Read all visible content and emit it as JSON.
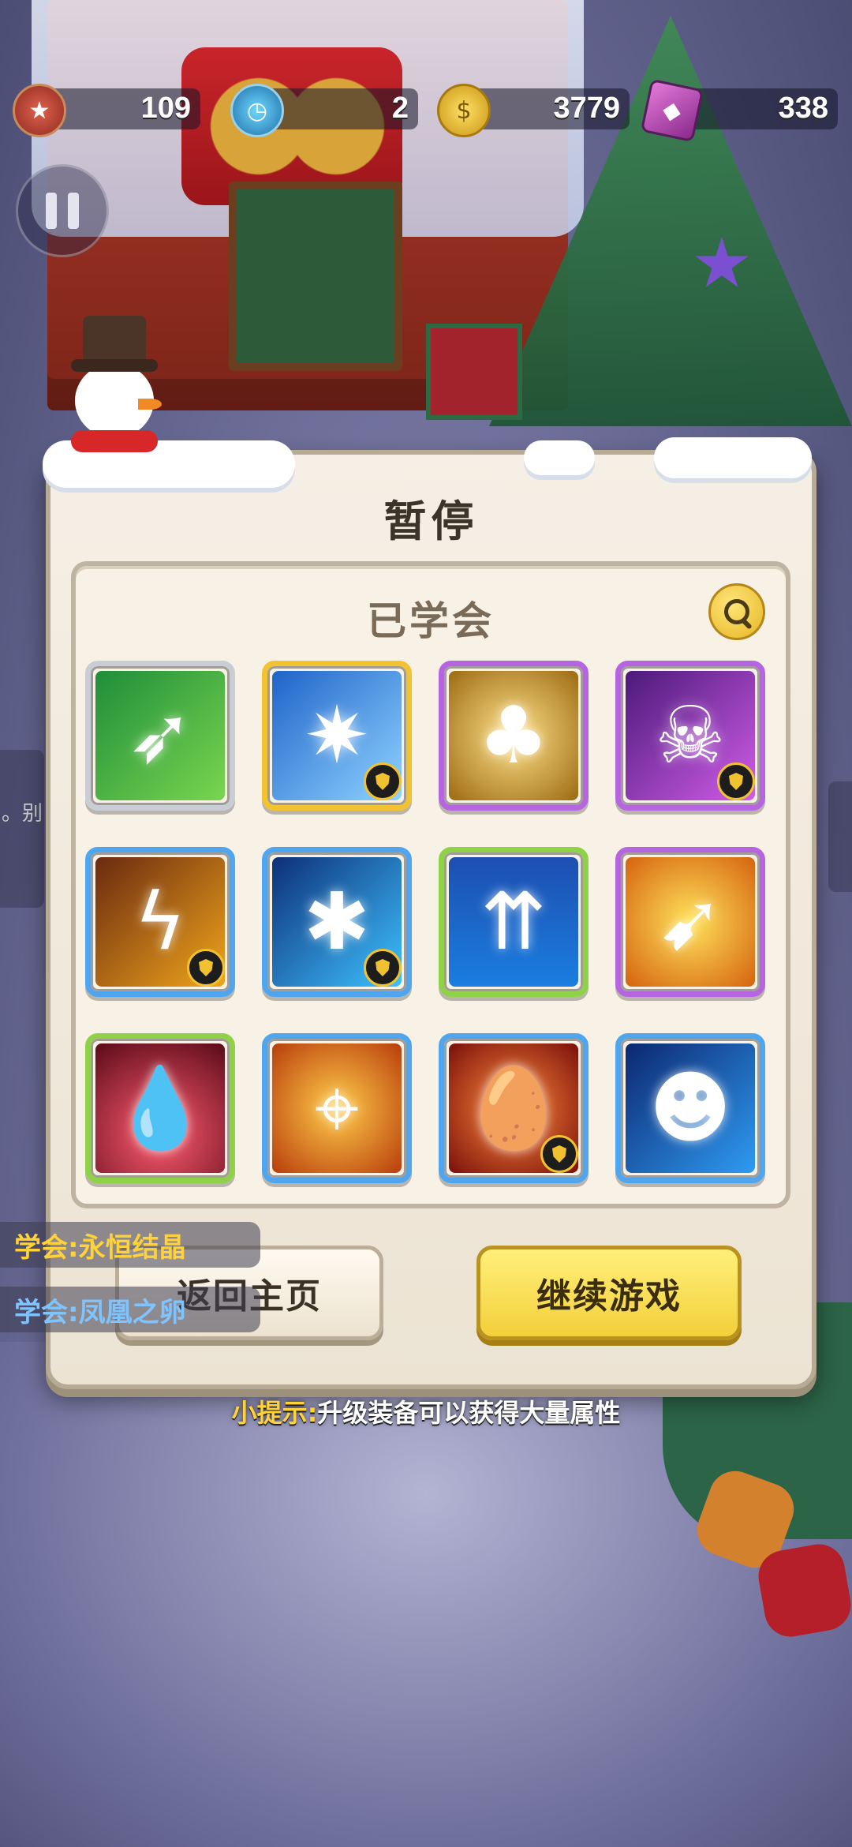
{
  "hud": {
    "medal": "109",
    "stopwatch": "2",
    "coins": "3779",
    "gems": "338"
  },
  "side_fragment": "。别",
  "dialog": {
    "title": "暂停",
    "learned_title": "已学会",
    "skills": [
      {
        "name": "green-arrow-skill-icon",
        "frame": "#c9ced6",
        "bg": "linear-gradient(135deg,#1f8e3a,#7ad64f)",
        "glyph": "➶",
        "shield": false
      },
      {
        "name": "ice-star-skill-icon",
        "frame": "#f2c230",
        "bg": "linear-gradient(135deg,#1f64c9,#8fd3ff)",
        "glyph": "✷",
        "shield": true
      },
      {
        "name": "clover-chest-skill-icon",
        "frame": "#b565e0",
        "bg": "radial-gradient(circle,#ffe28a,#9c6a12)",
        "glyph": "♣",
        "shield": false
      },
      {
        "name": "skull-orbit-skill-icon",
        "frame": "#b565e0",
        "bg": "linear-gradient(135deg,#4b1a7a,#d15ce8)",
        "glyph": "☠",
        "shield": true
      },
      {
        "name": "lightning-orbit-skill-icon",
        "frame": "#4fa6ef",
        "bg": "linear-gradient(135deg,#6a2a0f,#f0a51c)",
        "glyph": "ϟ",
        "shield": true
      },
      {
        "name": "frost-orbit-skill-icon",
        "frame": "#4fa6ef",
        "bg": "linear-gradient(135deg,#0d2f78,#3ec2ff)",
        "glyph": "✱",
        "shield": true
      },
      {
        "name": "double-arrow-up-skill-icon",
        "frame": "#8fd147",
        "bg": "linear-gradient(180deg,#1d4fb0,#1a7ee0)",
        "glyph": "⇈",
        "shield": false
      },
      {
        "name": "lightning-spear-skill-icon",
        "frame": "#b565e0",
        "bg": "radial-gradient(circle,#ffe35a,#d5620f)",
        "glyph": "➹",
        "shield": false
      },
      {
        "name": "blood-drop-skill-icon",
        "frame": "#8fd147",
        "bg": "radial-gradient(circle at 50% 70%,#ff5b6e,#5a0a19)",
        "glyph": "💧",
        "shield": false
      },
      {
        "name": "crosshair-skill-icon",
        "frame": "#4fa6ef",
        "bg": "radial-gradient(circle,#ffcc4a,#b83d0b)",
        "glyph": "⌖",
        "shield": false
      },
      {
        "name": "phoenix-egg-skill-icon",
        "frame": "#4fa6ef",
        "bg": "radial-gradient(circle,#ff8b3a,#7a0f0b)",
        "glyph": "🥚",
        "shield": true
      },
      {
        "name": "demon-spear-skill-icon",
        "frame": "#4fa6ef",
        "bg": "linear-gradient(135deg,#0c2770,#2f9bf2)",
        "glyph": "☻",
        "shield": false
      }
    ],
    "home_button": "返回主页",
    "continue_button": "继续游戏"
  },
  "toasts": [
    {
      "prefix": "学会:",
      "name": "永恒结晶"
    },
    {
      "prefix": "学会:",
      "name": "凤凰之卵"
    }
  ],
  "tip": {
    "lead": "小提示:",
    "text": "升级装备可以获得大量属性"
  },
  "colors": {
    "gold": "#ffd23a",
    "blue_text": "#7fc3ff"
  }
}
